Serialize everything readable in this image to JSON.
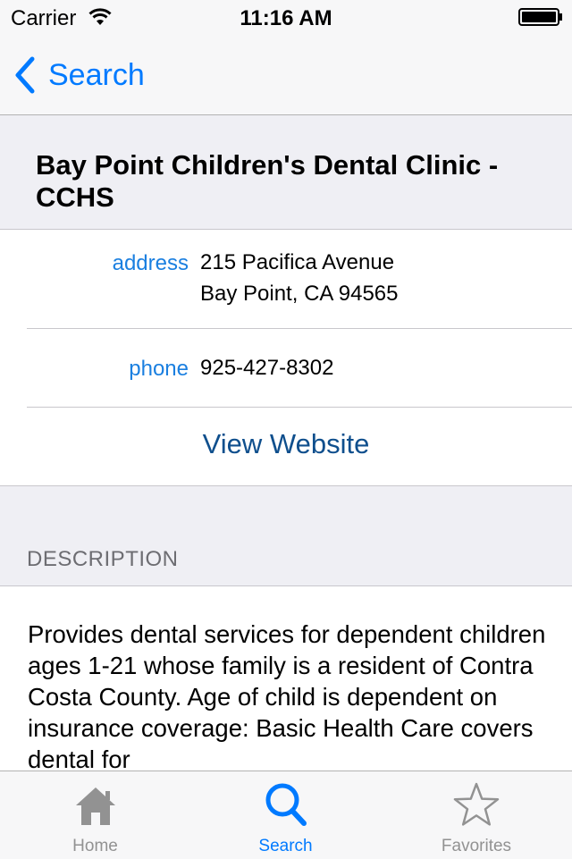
{
  "status_bar": {
    "carrier": "Carrier",
    "time": "11:16 AM"
  },
  "nav": {
    "back_label": "Search",
    "back_icon": "chevron-left-icon"
  },
  "clinic": {
    "name": "Bay Point Children's Dental Clinic - CCHS"
  },
  "details": {
    "address_label": "address",
    "address_line1": "215 Pacifica Avenue",
    "address_line2": "Bay Point, CA 94565",
    "phone_label": "phone",
    "phone_value": "925-427-8302",
    "website_label": "View Website"
  },
  "description": {
    "header": "DESCRIPTION",
    "text": "Provides dental services for dependent children ages 1-21 whose family is a resident of Contra Costa County. Age of child is dependent on insurance coverage: Basic Health Care covers dental for"
  },
  "tabbar": {
    "tabs": [
      {
        "label": "Home",
        "icon": "home-icon",
        "active": false
      },
      {
        "label": "Search",
        "icon": "search-icon",
        "active": true
      },
      {
        "label": "Favorites",
        "icon": "star-icon",
        "active": false
      }
    ]
  },
  "colors": {
    "accent": "#007aff",
    "label_blue": "#1a7fe0",
    "website_blue": "#0f4f8d",
    "inactive_gray": "#929292"
  }
}
